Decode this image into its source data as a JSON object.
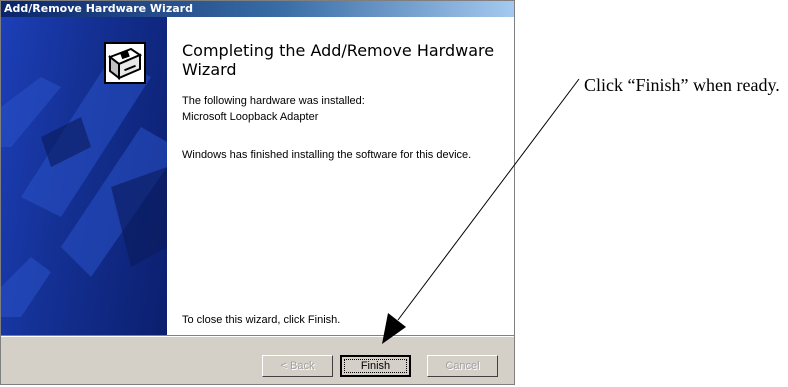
{
  "window": {
    "title": "Add/Remove Hardware Wizard"
  },
  "content": {
    "heading": "Completing the Add/Remove Hardware Wizard",
    "installed_intro": "The following hardware was installed:",
    "device_name": "Microsoft Loopback Adapter",
    "status_message": "Windows has finished installing the software for this device.",
    "close_hint": "To close this wizard, click Finish."
  },
  "buttons": {
    "back": {
      "label": "< Back",
      "enabled": false
    },
    "finish": {
      "label": "Finish",
      "enabled": true,
      "default": true
    },
    "cancel": {
      "label": "Cancel",
      "enabled": false
    }
  },
  "callout": {
    "text": "Click “Finish” when ready."
  },
  "colors": {
    "title_bar": "#0a246a",
    "banner": "#143195",
    "dialog_face": "#d4d0c8"
  },
  "icons": {
    "wizard": "hardware-wizard-icon",
    "callout_arrow": "arrow-icon"
  }
}
